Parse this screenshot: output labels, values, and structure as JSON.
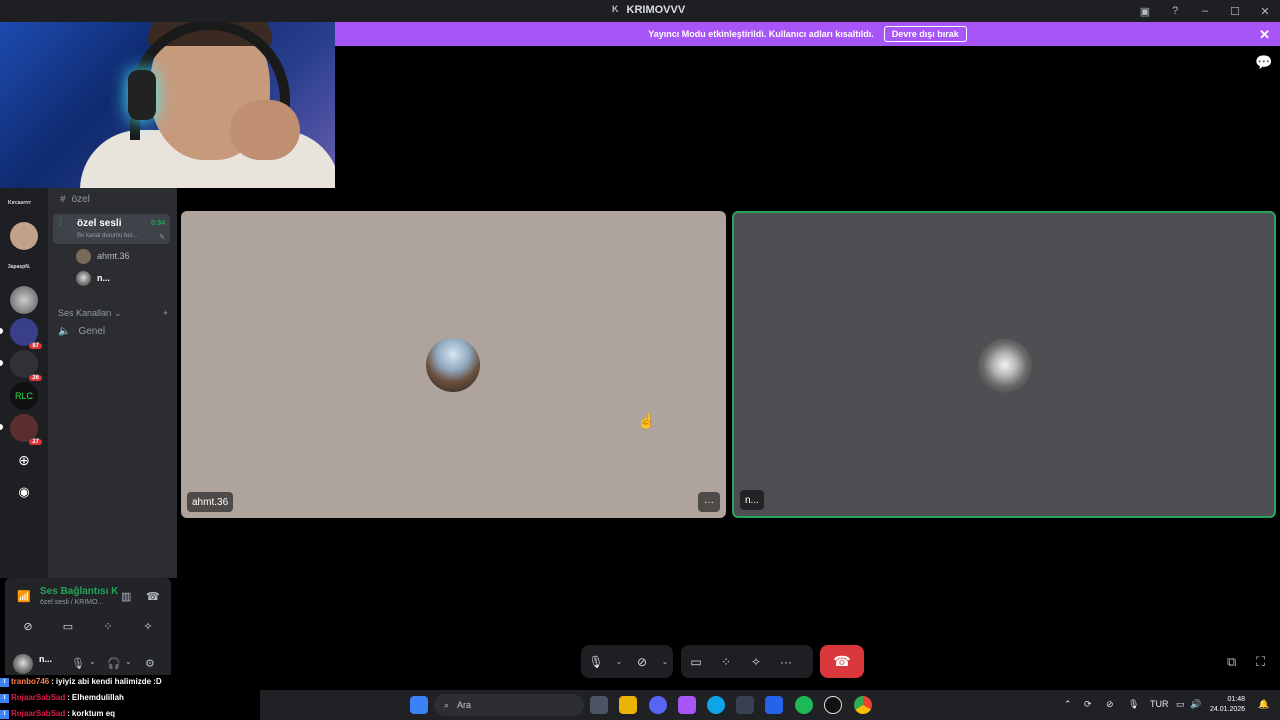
{
  "titlebar": {
    "k": "K",
    "title": "KRIMOVVV"
  },
  "banner": {
    "message": "Yayıncı Modu etkinleştirildi. Kullanıcı adları kısaltıldı.",
    "button": "Devre dışı bırak"
  },
  "rail": {
    "label1": "Kırcasrrrr",
    "label2": "3apaspN.",
    "badge1": "87",
    "badge2": "26",
    "badge3": "27",
    "srv_text": "RLC"
  },
  "channels": {
    "text_channel": "özel",
    "active": {
      "name": "özel sesli",
      "time": "0:34",
      "status": "Bir kanal durumu bel..."
    },
    "members": [
      {
        "name": "ahmt.36"
      },
      {
        "name": "n..."
      }
    ],
    "category": "Ses Kanalları",
    "genel": "Genel"
  },
  "voice_panel": {
    "connection": "Ses Bağlantısı K",
    "sub": "özel sesli / KRIMO..."
  },
  "user_panel": {
    "name": "n..."
  },
  "tiles": [
    {
      "label": "ahmt.36"
    },
    {
      "label": "n..."
    }
  ],
  "chat": [
    {
      "user": "tranbo746",
      "message": "iyiyiz abi kendi halimizde :D"
    },
    {
      "user": "RojaarSabSad",
      "message": "Elhemdulillah"
    },
    {
      "user": "RojaarSabSad",
      "message": "korktum eq"
    }
  ],
  "taskbar": {
    "search": "Ara",
    "lang": "TUR",
    "time": "01:48",
    "date": "24.01.2026"
  },
  "colors": {
    "banner": "#a855f7",
    "speaking_border": "#23a55a",
    "hangup": "#da373c",
    "tile1_bg": "#aea49d",
    "tile2_bg": "#4e4f53"
  }
}
